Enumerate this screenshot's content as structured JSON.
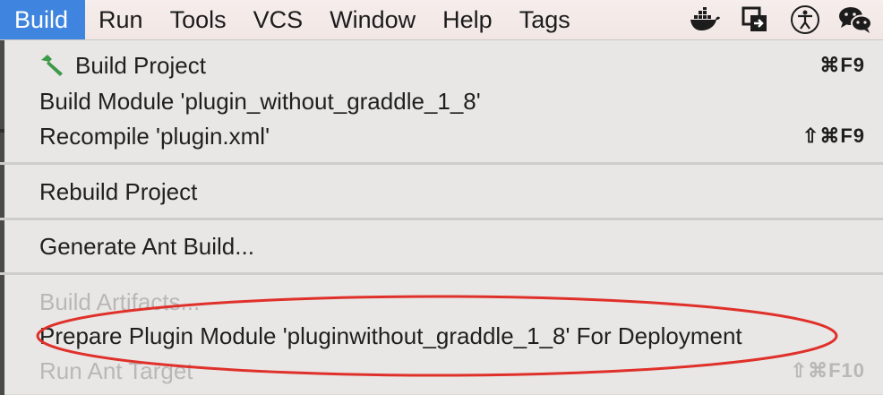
{
  "menubar": {
    "items": [
      {
        "label": "Build",
        "active": true
      },
      {
        "label": "Run"
      },
      {
        "label": "Tools"
      },
      {
        "label": "VCS"
      },
      {
        "label": "Window"
      },
      {
        "label": "Help"
      },
      {
        "label": "Tags"
      }
    ],
    "tray_icons": [
      "docker-icon",
      "screen-mirror-icon",
      "accessibility-icon",
      "wechat-icon"
    ]
  },
  "dropdown": {
    "items": [
      {
        "label": "Build Project",
        "shortcut": "⌘F9",
        "icon": "hammer-icon",
        "enabled": true
      },
      {
        "label": "Build Module 'plugin_without_graddle_1_8'",
        "shortcut": "",
        "enabled": true
      },
      {
        "label": "Recompile 'plugin.xml'",
        "shortcut": "⇧⌘F9",
        "enabled": true
      },
      {
        "label": "Rebuild Project",
        "shortcut": "",
        "enabled": true
      },
      {
        "label": "Generate Ant Build...",
        "shortcut": "",
        "enabled": true
      },
      {
        "label": "Build Artifacts...",
        "shortcut": "",
        "enabled": false
      },
      {
        "label": "Prepare Plugin Module 'pluginwithout_graddle_1_8' For Deployment",
        "shortcut": "",
        "enabled": true,
        "highlighted": true
      },
      {
        "label": "Run Ant Target",
        "shortcut": "⇧⌘F10",
        "enabled": false
      }
    ]
  },
  "colors": {
    "menubar_active": "#3f85df",
    "highlight_ring": "#e0302a",
    "hammer": "#3f9a4a"
  }
}
